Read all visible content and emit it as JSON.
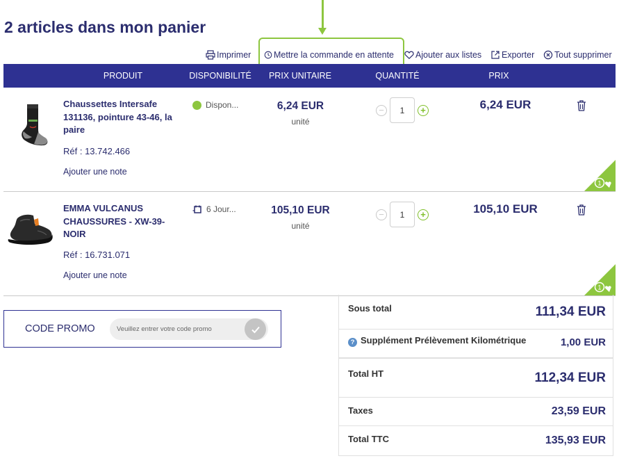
{
  "page": {
    "title": "2 articles dans mon panier"
  },
  "toolbar": {
    "print": "Imprimer",
    "hold": "Mettre la commande en attente",
    "lists": "Ajouter aux listes",
    "export": "Exporter",
    "delete_all": "Tout supprimer"
  },
  "table": {
    "headers": {
      "product": "PRODUIT",
      "availability": "DISPONIBILITÉ",
      "unit_price": "PRIX UNITAIRE",
      "quantity": "QUANTITÉ",
      "price": "PRIX"
    }
  },
  "items": [
    {
      "name": "Chaussettes Intersafe 131136, pointure 43-46, la paire",
      "ref": "Réf : 13.742.466",
      "note_link": "Ajouter une note",
      "availability": "Dispon...",
      "availability_icon": "green-dot",
      "unit_price": "6,24 EUR",
      "unit_label": "unité",
      "quantity": "1",
      "price": "6,24 EUR",
      "badge_count": "1"
    },
    {
      "name": "EMMA VULCANUS CHAUSSURES - XW-39-NOIR",
      "ref": "Réf : 16.731.071",
      "note_link": "Ajouter une note",
      "availability": "6 Jour...",
      "availability_icon": "calendar-icon",
      "unit_price": "105,10 EUR",
      "unit_label": "unité",
      "quantity": "1",
      "price": "105,10 EUR",
      "badge_count": "1"
    }
  ],
  "promo": {
    "label": "CODE PROMO",
    "placeholder": "Veuillez entrer votre code promo"
  },
  "totals": {
    "subtotal_label": "Sous total",
    "subtotal": "111,34 EUR",
    "supplement_label": "Supplément Prélèvement Kilométrique",
    "supplement": "1,00 EUR",
    "total_ht_label": "Total HT",
    "total_ht": "112,34 EUR",
    "taxes_label": "Taxes",
    "taxes": "23,59 EUR",
    "total_ttc_label": "Total TTC",
    "total_ttc": "135,93 EUR"
  },
  "colors": {
    "brand_navy": "#2e3192",
    "accent_green": "#8dc63f",
    "text_navy": "#2b2d6e"
  }
}
